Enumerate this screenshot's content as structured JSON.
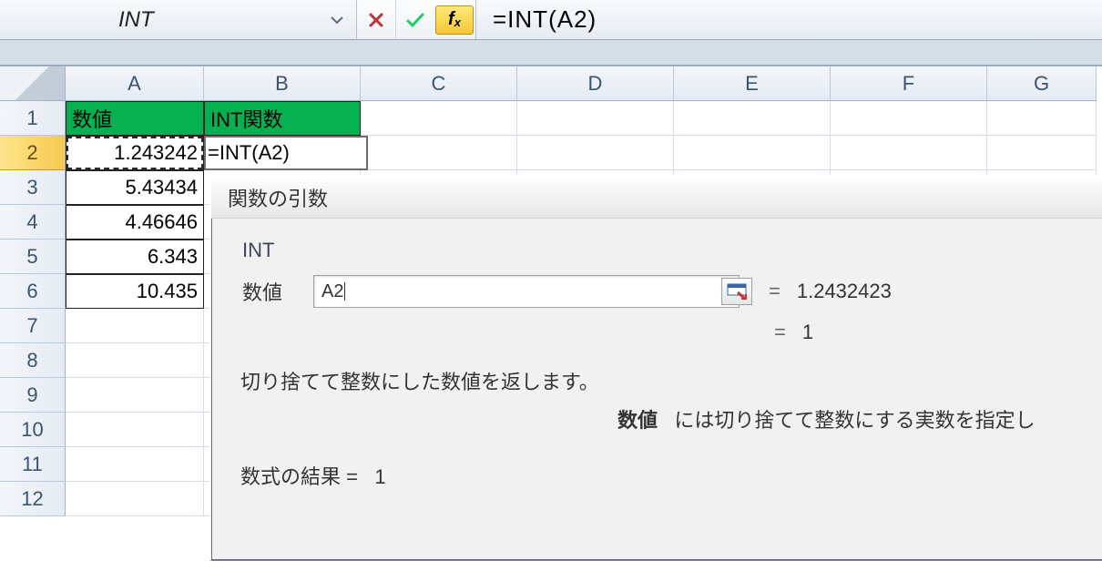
{
  "formula_bar": {
    "name_box": "INT",
    "formula": "=INT(A2)"
  },
  "columns": [
    "A",
    "B",
    "C",
    "D",
    "E",
    "F",
    "G"
  ],
  "rows": [
    "1",
    "2",
    "3",
    "4",
    "5",
    "6",
    "7",
    "8",
    "9",
    "10",
    "11",
    "12"
  ],
  "active_row": "2",
  "cells": {
    "headerA": "数値",
    "headerB": "INT関数",
    "a2": "1.243242",
    "b2": "=INT(A2)",
    "a3": "5.43434",
    "a4": "4.46646",
    "a5": "6.343",
    "a6": "10.435"
  },
  "dialog": {
    "title": "関数の引数",
    "func": "INT",
    "arg_label": "数値",
    "arg_value": "A2",
    "arg_eval": "1.2432423",
    "func_eval": "1",
    "description": "切り捨てて整数にした数値を返します。",
    "arg_description_label": "数値",
    "arg_description": "には切り捨てて整数にする実数を指定し",
    "result_label": "数式の結果 =",
    "result_value": "1",
    "eq": "="
  }
}
